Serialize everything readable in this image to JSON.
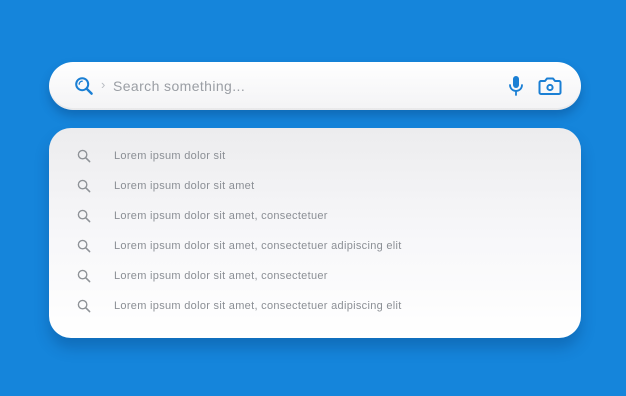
{
  "search": {
    "placeholder": "Search something...",
    "value": "",
    "chevron": "›",
    "icons": {
      "search": "search-icon",
      "mic": "microphone-icon",
      "camera": "camera-icon"
    }
  },
  "suggestions": [
    {
      "label": "Lorem ipsum dolor sit",
      "icon": "search-icon"
    },
    {
      "label": "Lorem ipsum dolor sit amet",
      "icon": "search-icon"
    },
    {
      "label": "Lorem ipsum dolor sit amet, consectetuer",
      "icon": "search-icon"
    },
    {
      "label": "Lorem ipsum dolor sit amet, consectetuer adipiscing elit",
      "icon": "search-icon"
    },
    {
      "label": "Lorem ipsum dolor sit amet, consectetuer",
      "icon": "search-icon"
    },
    {
      "label": "Lorem ipsum dolor sit amet, consectetuer adipiscing elit",
      "icon": "search-icon"
    }
  ],
  "colors": {
    "background": "#1585db",
    "accent": "#1a7fd4",
    "suggestion_text": "#8b8f95",
    "placeholder": "#9a9ea4"
  }
}
